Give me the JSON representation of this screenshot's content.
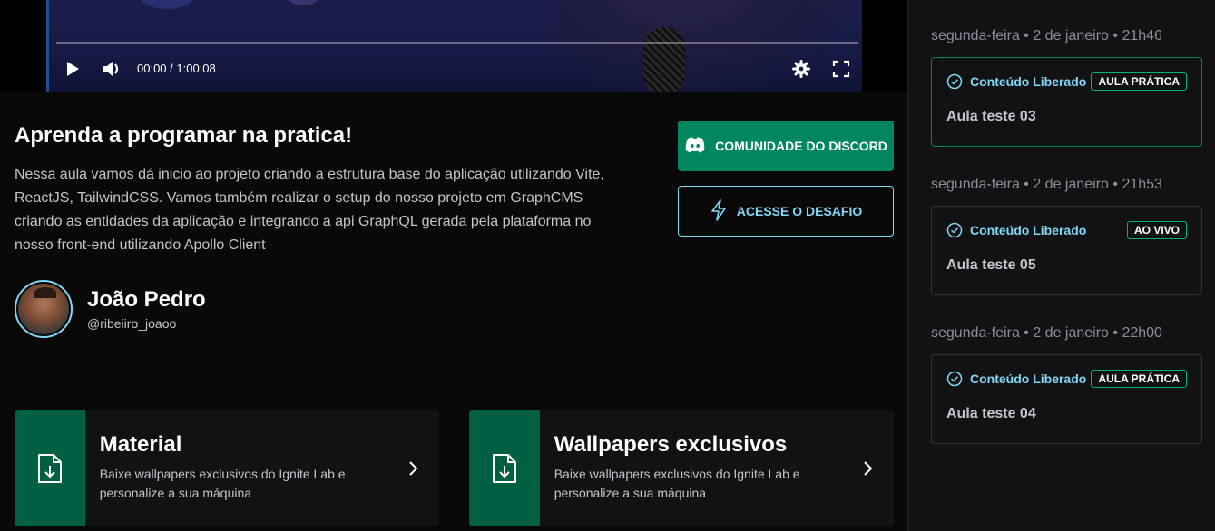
{
  "player": {
    "time_display": "00:00 / 1:00:08"
  },
  "lesson": {
    "title": "Aprenda a programar na pratica!",
    "description": "Nessa aula vamos dá inicio ao projeto criando a estrutura base do aplicação utilizando Vite, ReactJS, TailwindCSS. Vamos também realizar o setup do nosso projeto em GraphCMS criando as entidades da aplicação e integrando a api GraphQL gerada pela plataforma no nosso front-end utilizando Apollo Client"
  },
  "author": {
    "name": "João Pedro",
    "handle": "@ribeiiro_joaoo"
  },
  "buttons": {
    "discord": "COMUNIDADE DO DISCORD",
    "challenge": "ACESSE O DESAFIO"
  },
  "cards": [
    {
      "title": "Material",
      "description": "Baixe wallpapers exclusivos do Ignite Lab e personalize a sua máquina"
    },
    {
      "title": "Wallpapers exclusivos",
      "description": "Baixe wallpapers exclusivos do Ignite Lab e personalize a sua máquina"
    }
  ],
  "sidebar": {
    "lessons": [
      {
        "date": "segunda-feira • 2 de janeiro • 21h46",
        "status": "Conteúdo Liberado",
        "badge": "AULA PRÁTICA",
        "name": "Aula teste 03",
        "active": true
      },
      {
        "date": "segunda-feira • 2 de janeiro • 21h53",
        "status": "Conteúdo Liberado",
        "badge": "AO VIVO",
        "name": "Aula teste 05",
        "active": false
      },
      {
        "date": "segunda-feira • 2 de janeiro • 22h00",
        "status": "Conteúdo Liberado",
        "badge": "AULA PRÁTICA",
        "name": "Aula teste 04",
        "active": false
      }
    ]
  },
  "colors": {
    "accent_green": "#00875f",
    "accent_blue": "#81d8f7",
    "card_icon_bg": "#015f43",
    "background": "#09090a",
    "sidebar_bg": "#121214"
  },
  "icons": {
    "play": "play-icon",
    "volume": "volume-icon",
    "settings": "gear-icon",
    "fullscreen": "fullscreen-icon",
    "discord": "discord-icon",
    "challenge": "lightning-icon",
    "file": "file-download-icon",
    "arrow": "chevron-right-icon",
    "status": "check-circle-icon"
  }
}
